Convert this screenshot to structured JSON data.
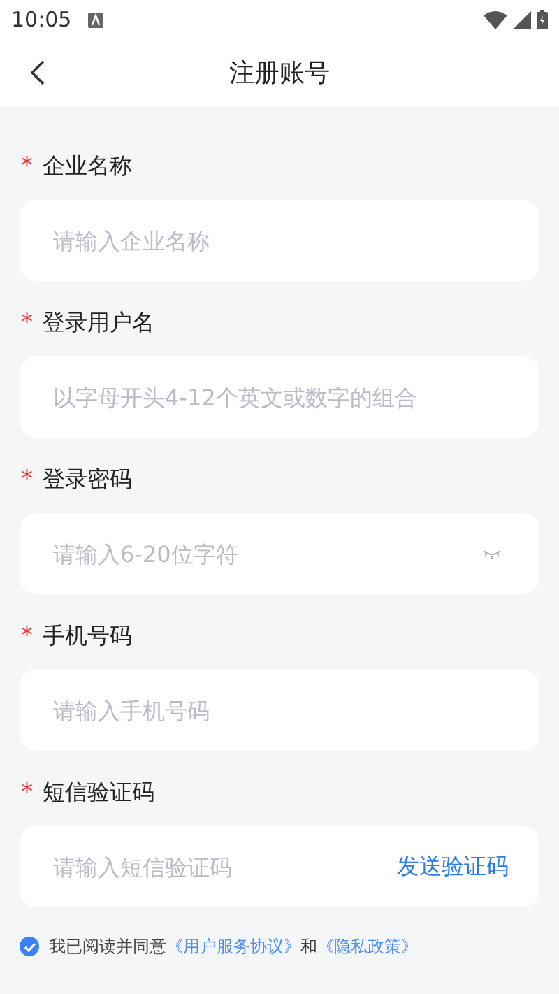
{
  "status_bar": {
    "time": "10:05"
  },
  "header": {
    "title": "注册账号"
  },
  "fields": [
    {
      "kind": "text",
      "label": "企业名称",
      "required_mark": "*",
      "placeholder": "请输入企业名称"
    },
    {
      "kind": "text",
      "label": "登录用户名",
      "required_mark": "*",
      "placeholder": "以字母开头4-12个英文或数字的组合"
    },
    {
      "kind": "password",
      "label": "登录密码",
      "required_mark": "*",
      "placeholder": "请输入6-20位字符"
    },
    {
      "kind": "text",
      "label": "手机号码",
      "required_mark": "*",
      "placeholder": "请输入手机号码"
    },
    {
      "kind": "sms",
      "label": "短信验证码",
      "required_mark": "*",
      "placeholder": "请输入短信验证码",
      "action": "发送验证码"
    }
  ],
  "agreement": {
    "checked": true,
    "parts": [
      {
        "kind": "text",
        "text": "我已阅读并同意"
      },
      {
        "kind": "link",
        "text": "《用户服务协议》"
      },
      {
        "kind": "text",
        "text": "和"
      },
      {
        "kind": "link",
        "text": "《隐私政策》"
      }
    ]
  }
}
